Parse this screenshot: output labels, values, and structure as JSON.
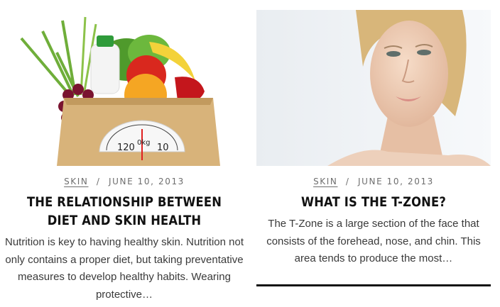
{
  "posts": [
    {
      "category": "Skin",
      "separator": "/",
      "date": "June 10, 2013",
      "title": "The Relationship Between Diet and Skin Health",
      "excerpt": "Nutrition is key to having healthy skin. Nutrition not only contains a proper diet, but taking preventative measures to develop healthy habits. Wearing protective…",
      "image_scale_labels": {
        "left": "120",
        "center": "0kg",
        "right": "10"
      }
    },
    {
      "category": "Skin",
      "separator": "/",
      "date": "June 10, 2013",
      "title": "What is the T-Zone?",
      "excerpt": "The T-Zone is a large section of the face that consists of the forehead, nose, and chin. This area tends to produce the most…"
    }
  ]
}
